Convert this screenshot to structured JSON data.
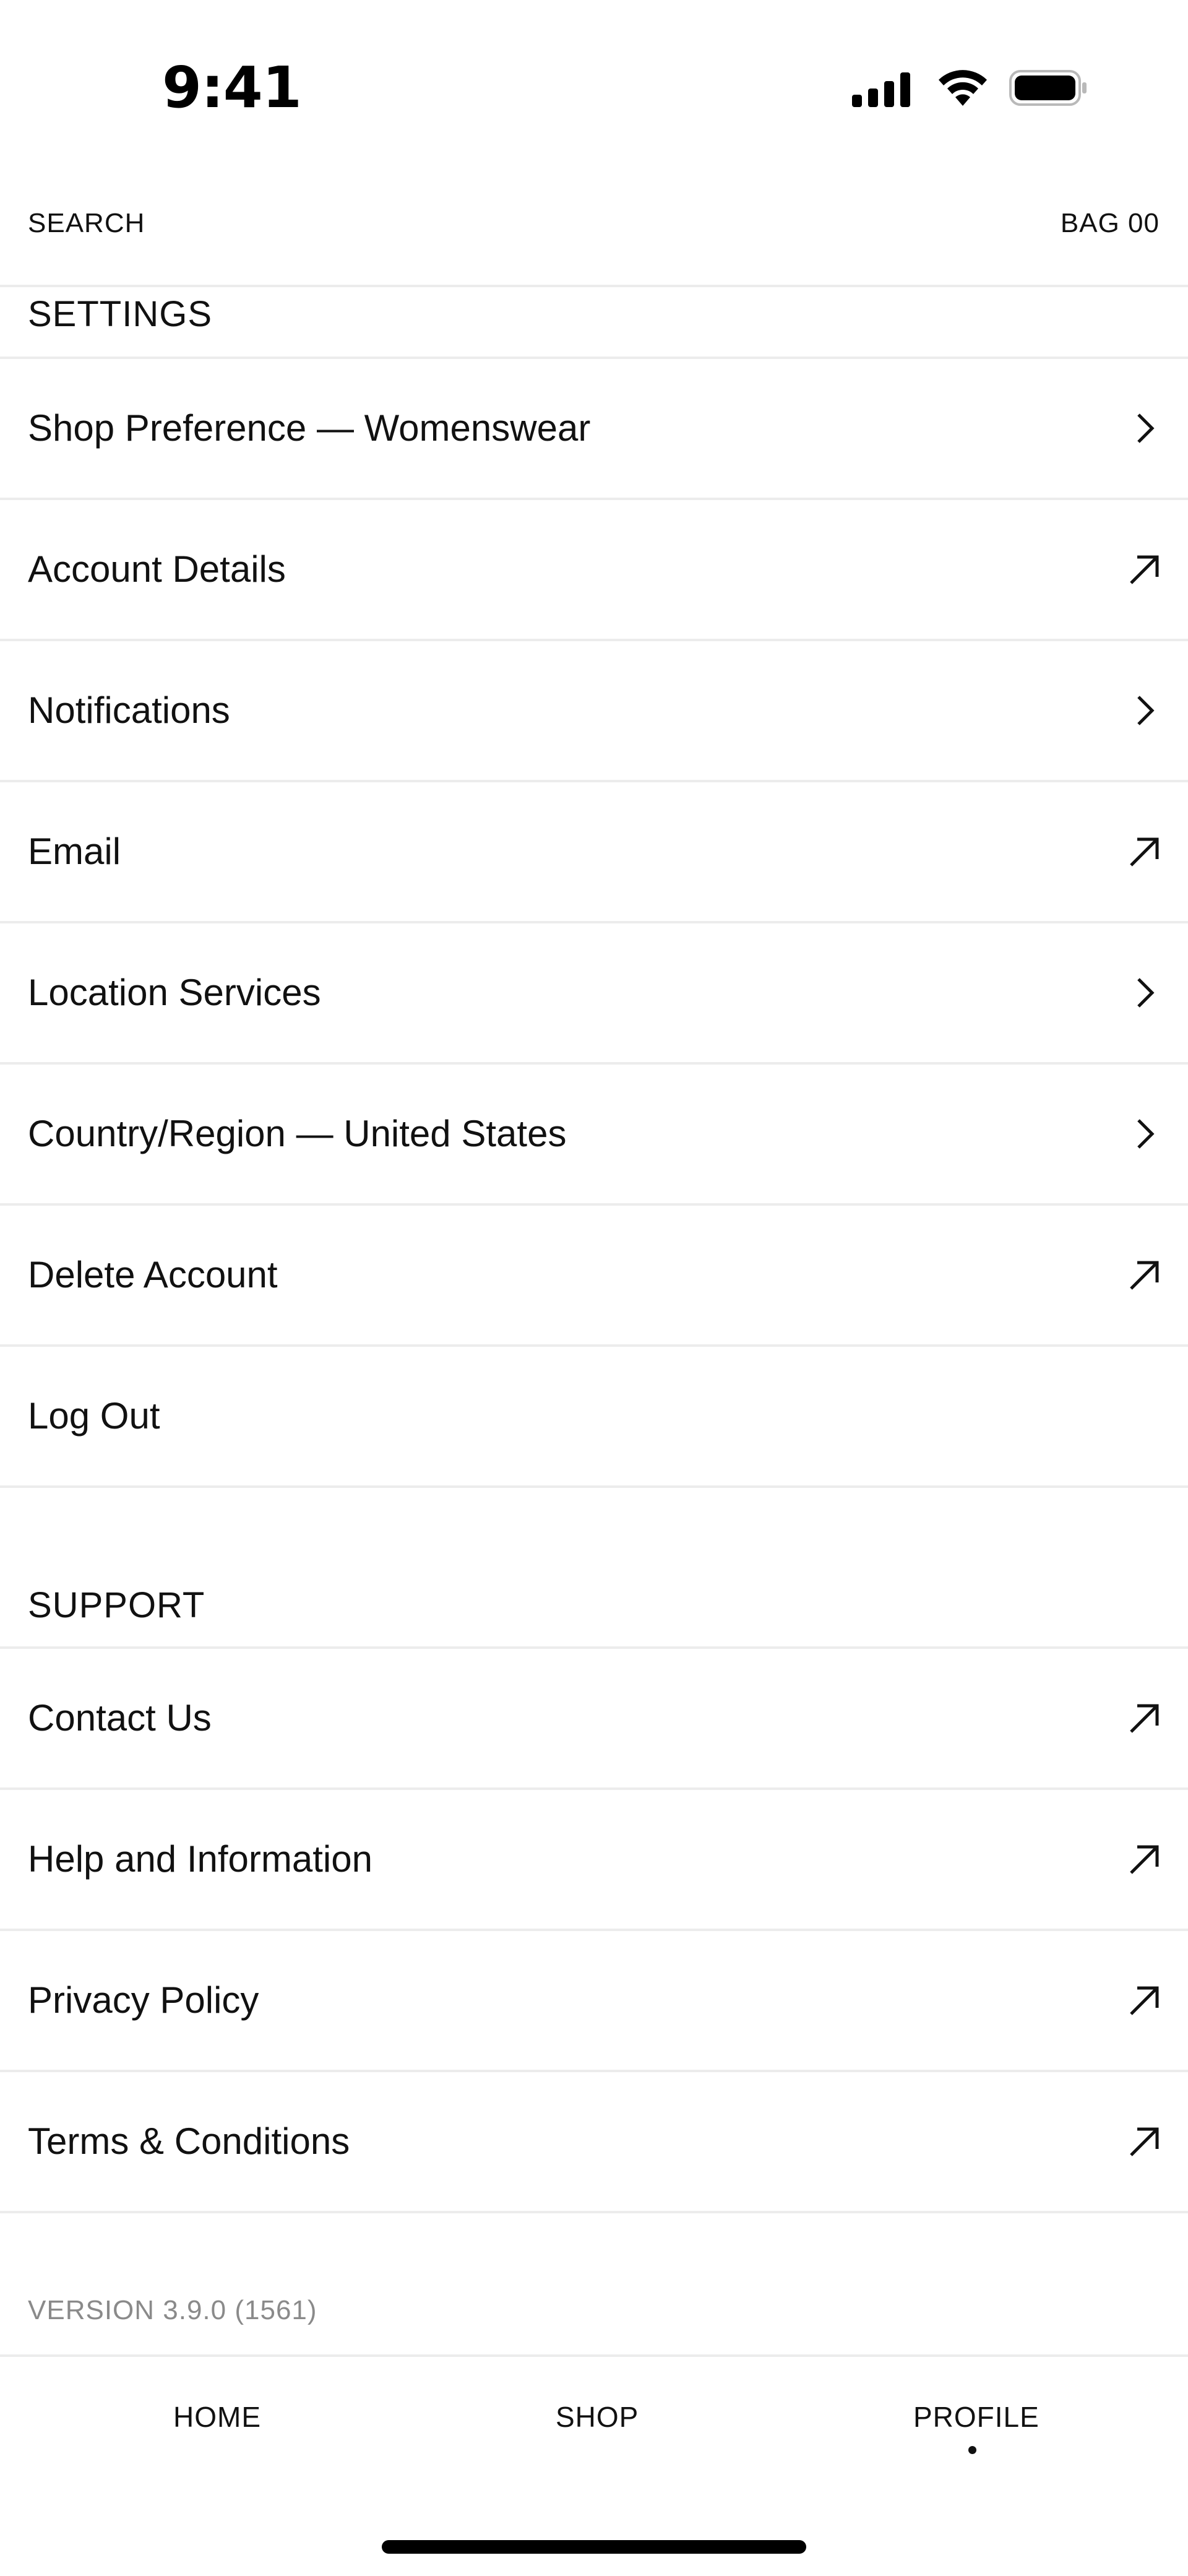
{
  "status_bar": {
    "time": "9:41",
    "icons": [
      "cellular-signal-icon",
      "wifi-icon",
      "battery-icon"
    ]
  },
  "top_nav": {
    "search_label": "SEARCH",
    "bag_label": "BAG 00"
  },
  "settings": {
    "header": "SETTINGS",
    "items": [
      {
        "label": "Shop Preference — Womenswear",
        "icon": "chevron-right-icon"
      },
      {
        "label": "Account Details",
        "icon": "external-link-arrow-icon"
      },
      {
        "label": "Notifications",
        "icon": "chevron-right-icon"
      },
      {
        "label": "Email",
        "icon": "external-link-arrow-icon"
      },
      {
        "label": "Location Services",
        "icon": "chevron-right-icon"
      },
      {
        "label": "Country/Region — United States",
        "icon": "chevron-right-icon"
      },
      {
        "label": "Delete Account",
        "icon": "external-link-arrow-icon"
      },
      {
        "label": "Log Out",
        "icon": ""
      }
    ]
  },
  "support": {
    "header": "SUPPORT",
    "items": [
      {
        "label": "Contact Us",
        "icon": "external-link-arrow-icon"
      },
      {
        "label": "Help and Information",
        "icon": "external-link-arrow-icon"
      },
      {
        "label": "Privacy Policy",
        "icon": "external-link-arrow-icon"
      },
      {
        "label": "Terms & Conditions",
        "icon": "external-link-arrow-icon"
      }
    ]
  },
  "version": "VERSION 3.9.0 (1561)",
  "bottom_nav": {
    "tabs": [
      {
        "label": "HOME"
      },
      {
        "label": "SHOP"
      },
      {
        "label": "PROFILE"
      }
    ],
    "active_tab": "PROFILE"
  },
  "colors": {
    "text": "#111111",
    "divider": "#ececec",
    "muted": "#8a8a8a",
    "background": "#ffffff"
  }
}
